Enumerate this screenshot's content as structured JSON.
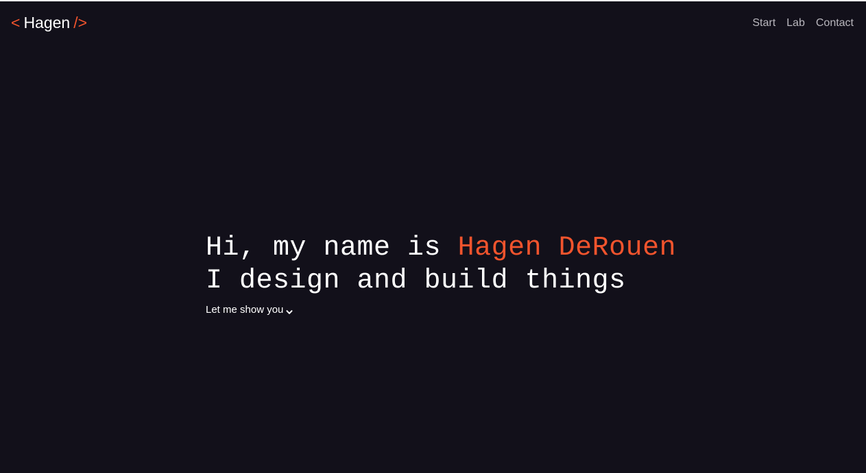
{
  "header": {
    "logo": {
      "bracket_open": "<",
      "name": "Hagen",
      "bracket_close": "/>"
    },
    "nav": [
      {
        "label": "Start"
      },
      {
        "label": "Lab"
      },
      {
        "label": "Contact"
      }
    ]
  },
  "hero": {
    "line1_prefix": "Hi, my name is ",
    "line1_name": "Hagen DeRouen",
    "line2": "I design and build things",
    "cta_label": "Let me show you",
    "cta_icon": "chevron-down-icon"
  },
  "colors": {
    "background": "#12101a",
    "accent": "#f2542d",
    "text": "#ffffff",
    "nav_text": "#b9b7bd"
  }
}
